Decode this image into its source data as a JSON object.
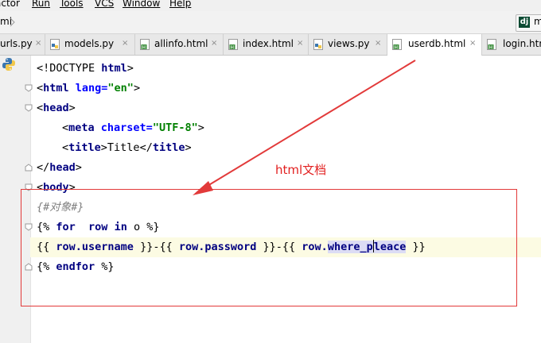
{
  "menu": {
    "items": [
      {
        "label": "actor"
      },
      {
        "label": "Run"
      },
      {
        "label": "Tools"
      },
      {
        "label": "VCS"
      },
      {
        "label": "Window"
      },
      {
        "label": "Help"
      }
    ]
  },
  "toolbar": {
    "breadcrumb": "ml",
    "run_config_icon": "dj",
    "run_config_label": "m"
  },
  "tabs": [
    {
      "label": "urls.py",
      "icon": "python-file-icon",
      "active": false
    },
    {
      "label": "models.py",
      "icon": "python-file-icon",
      "active": false
    },
    {
      "label": "allinfo.html",
      "icon": "html-file-icon",
      "active": false
    },
    {
      "label": "index.html",
      "icon": "html-file-icon",
      "active": false
    },
    {
      "label": "views.py",
      "icon": "python-file-icon",
      "active": false
    },
    {
      "label": "userdb.html",
      "icon": "html-file-icon",
      "active": true
    },
    {
      "label": "login.htm",
      "icon": "html-file-icon",
      "active": false
    }
  ],
  "tab_close_glyph": "×",
  "code": {
    "l1": {
      "a": "<!DOCTYPE ",
      "b": "html",
      "c": ">"
    },
    "l2": {
      "a": "<",
      "b": "html ",
      "c": "lang=",
      "d": "\"en\"",
      "e": ">"
    },
    "l3": {
      "a": "<",
      "b": "head",
      "c": ">"
    },
    "l4": {
      "a": "<",
      "b": "meta ",
      "c": "charset=",
      "d": "\"UTF-8\"",
      "e": ">"
    },
    "l5": {
      "a": "<",
      "b": "title",
      "c": ">",
      "d": "Title",
      "e": "</",
      "f": "title",
      "g": ">"
    },
    "l6": {
      "a": "</",
      "b": "head",
      "c": ">"
    },
    "l7": {
      "a": "<",
      "b": "body",
      "c": ">"
    },
    "l8": {
      "a": "{#对象#}"
    },
    "l9": {
      "a": "{% ",
      "b": "for",
      "c": "  row ",
      "d": "in",
      "e": " o %}"
    },
    "l10": {
      "a": "{{ ",
      "b": "row.username",
      "c": " }}-{{ ",
      "d": "row.password",
      "e": " }}-{{ ",
      "f": "row.",
      "g": "where_p",
      "h": "leace",
      "i": " }}"
    },
    "l11": {
      "a": "{% ",
      "b": "endfor",
      "c": " %}"
    }
  },
  "annotation": {
    "label": "html文档",
    "color": "#e22020"
  },
  "colors": {
    "tag": "#000080",
    "attr": "#0000ff",
    "string": "#008000",
    "comment": "#808080",
    "caret_line": "#fcfbe3",
    "highlight": "#dcdcf4"
  }
}
